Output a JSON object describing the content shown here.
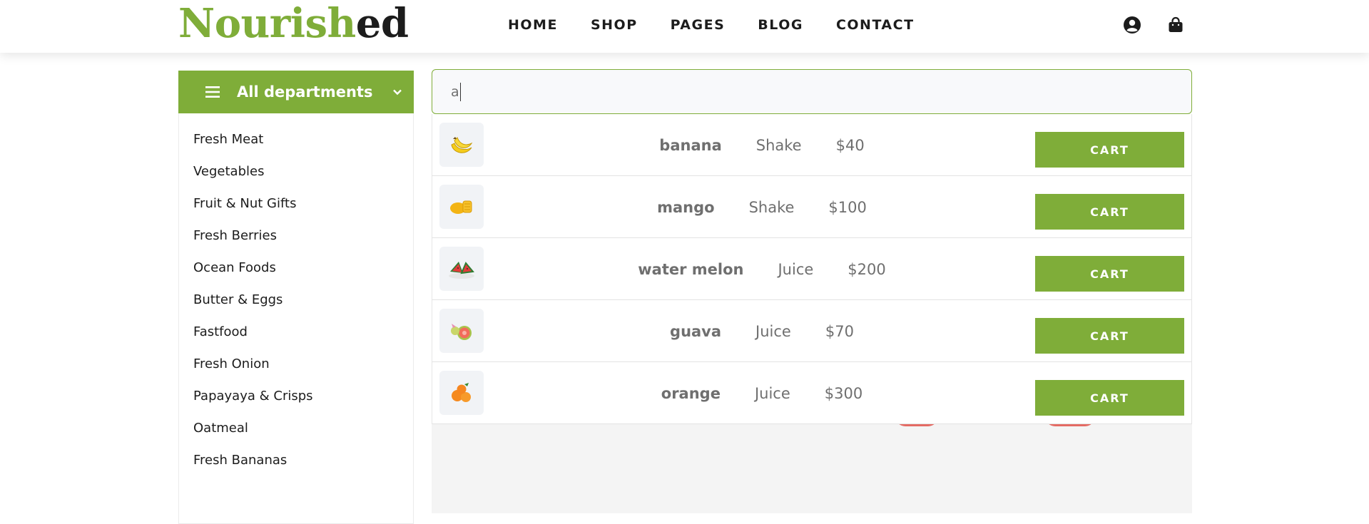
{
  "logo": {
    "part1": "Nourish",
    "part2": "ed"
  },
  "nav": [
    "HOME",
    "SHOP",
    "PAGES",
    "BLOG",
    "CONTACT"
  ],
  "icons": {
    "user": "user-circle-icon",
    "cart": "shopping-bag-icon"
  },
  "departments": {
    "title": "All departments",
    "items": [
      "Fresh Meat",
      "Vegetables",
      "Fruit & Nut Gifts",
      "Fresh Berries",
      "Ocean Foods",
      "Butter & Eggs",
      "Fastfood",
      "Fresh Onion",
      "Papayaya & Crisps",
      "Oatmeal",
      "Fresh Bananas"
    ]
  },
  "search": {
    "value": "a"
  },
  "results": [
    {
      "name": "banana",
      "category": "Shake",
      "price": "$40",
      "button": "CART",
      "icon": "banana-icon"
    },
    {
      "name": "mango",
      "category": "Shake",
      "price": "$100",
      "button": "CART",
      "icon": "mango-icon"
    },
    {
      "name": "water melon",
      "category": "Juice",
      "price": "$200",
      "button": "CART",
      "icon": "watermelon-icon"
    },
    {
      "name": "guava",
      "category": "Juice",
      "price": "$70",
      "button": "CART",
      "icon": "guava-icon"
    },
    {
      "name": "orange",
      "category": "Juice",
      "price": "$300",
      "button": "CART",
      "icon": "orange-icon"
    }
  ],
  "colors": {
    "accent": "#7fad39",
    "text": "#1c1c1c",
    "muted": "#6f6f6f"
  }
}
